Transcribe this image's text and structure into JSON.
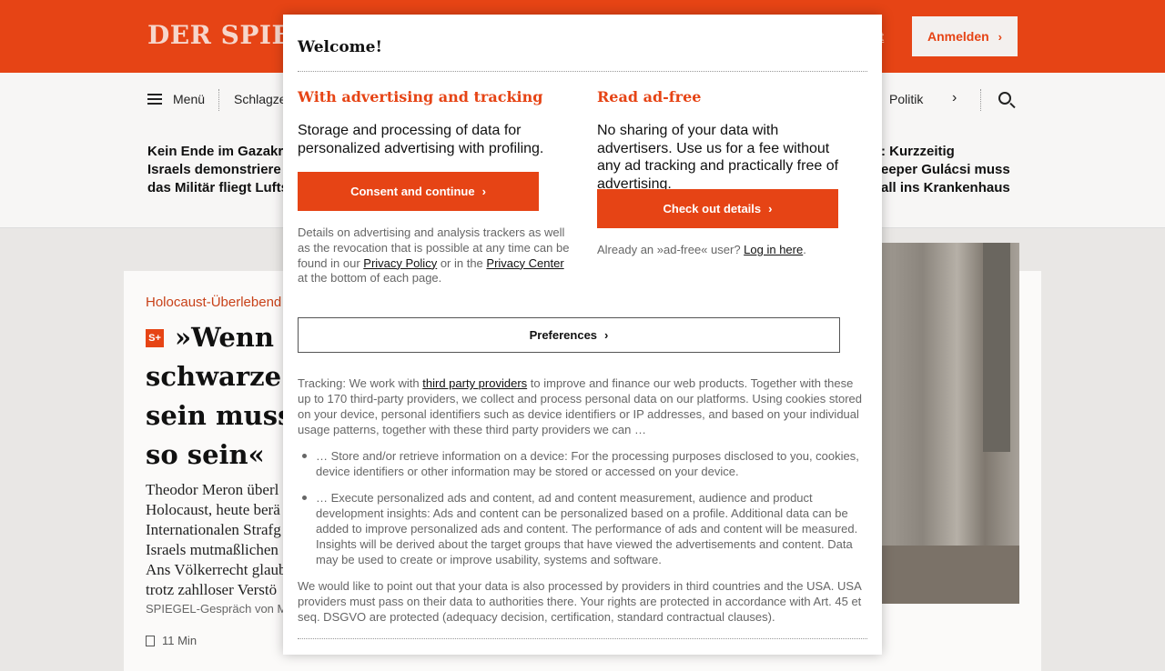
{
  "header": {
    "logo": "DER SPIEGEL",
    "top_link": "nt",
    "login_label": "Anmelden"
  },
  "nav": {
    "menu_label": "Menü",
    "items": [
      "Schlagze",
      "Politik"
    ]
  },
  "ticker": {
    "left": [
      "Kein Ende im Gazakri",
      "Israels demonstriere",
      "das Militär fliegt Lufts"
    ],
    "right": [
      ": Kurzzeitig",
      "eeper Gulácsi muss",
      "all ins Krankenhaus"
    ]
  },
  "article": {
    "kicker": "Holocaust-Überlebend",
    "badge": "S+",
    "headline": [
      "»Wenn ic",
      "schwarze S",
      "sein muss,",
      "so sein«"
    ],
    "teaser": [
      "Theodor Meron überl",
      "Holocaust, heute berä",
      "Internationalen Strafg",
      "Israels mutmaßlichen",
      "Ans Völkerrecht glaub",
      "trotz zahlloser Verstö"
    ],
    "byline": "SPIEGEL-Gespräch von M",
    "read_time": "11 Min"
  },
  "consent": {
    "title": "Welcome!",
    "left": {
      "heading": "With advertising and tracking",
      "text": "Storage and processing of data for personalized advertising with profiling.",
      "button": "Consent and continue",
      "details_1": "Details on advertising and analysis trackers as well as the revocation that is possible at any time can be found in our ",
      "privacy_policy": "Privacy Policy",
      "details_2": " or in the ",
      "privacy_center": "Privacy Center",
      "details_3": " at the bottom of each page."
    },
    "right": {
      "heading": "Read ad-free",
      "text": "No sharing of your data with advertisers. Use us for a fee without any ad tracking and practically free of advertising.",
      "button": "Check out details",
      "already_1": "Already an »ad-free« user? ",
      "login_link": "Log in here",
      "already_2": "."
    },
    "preferences_button": "Preferences",
    "tracking_1": "Tracking: We work with ",
    "third_party_link": "third party providers",
    "tracking_2": " to improve and finance our web products. Together with these up to 170 third-party providers, we collect and process personal data on our platforms. Using cookies stored on your device, personal identifiers such as device identifiers or IP addresses, and based on your individual usage patterns, together with these third party providers we can …",
    "bullets": [
      "… Store and/or retrieve information on a device: For the processing purposes disclosed to you, cookies, device identifiers or other information may be stored or accessed on your device.",
      "… Execute personalized ads and content, ad and content measurement, audience and product development insights: Ads and content can be personalized based on a profile. Additional data can be added to improve personalized ads and content. The performance of ads and content will be measured. Insights will be derived about the target groups that have viewed the advertisements and content. Data may be used to create or improve usability, systems and software."
    ],
    "third_countries": "We would like to point out that your data is also processed by providers in third countries and the USA. USA providers must pass on their data to authorities there. Your rights are protected in accordance with Art. 45 et seq. DSGVO are protected (adequacy decision, certification, standard contractual clauses)."
  },
  "colors": {
    "brand": "#e64415",
    "text_muted": "#666666"
  }
}
